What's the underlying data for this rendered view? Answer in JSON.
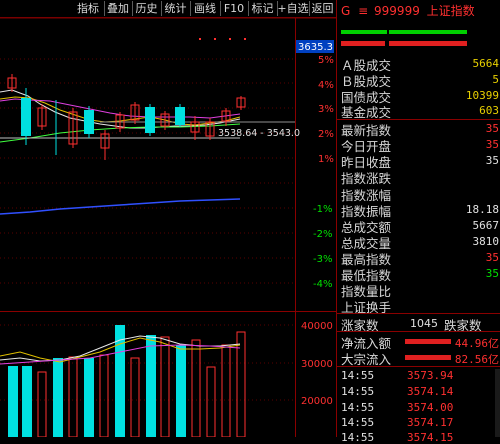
{
  "toolbar": {
    "items": [
      "指标",
      "叠加",
      "历史",
      "统计",
      "画线",
      "F10",
      "标记",
      "+自选",
      "返回"
    ]
  },
  "chart": {
    "price_marker": "3635.3",
    "range_label": "3538.64 - 3543.0",
    "pct_ticks": [
      "5%",
      "4%",
      "3%",
      "2%",
      "1%",
      "-1%",
      "-2%",
      "-3%",
      "-4%"
    ],
    "vol_ticks": [
      "40000",
      "30000",
      "20000"
    ]
  },
  "panel": {
    "badge": "G",
    "menu_glyph": "≡",
    "code": "999999",
    "name": "上证指数",
    "rows": [
      {
        "label": "Ａ股成交",
        "value": "5664"
      },
      {
        "label": "Ｂ股成交",
        "value": "5"
      },
      {
        "label": "国债成交",
        "value": "10399"
      },
      {
        "label": "基金成交",
        "value": "603"
      },
      {
        "label": "最新指数",
        "value": "35"
      },
      {
        "label": "今日开盘",
        "value": "35"
      },
      {
        "label": "昨日收盘",
        "value": "35"
      },
      {
        "label": "指数涨跌",
        "value": ""
      },
      {
        "label": "指数涨幅",
        "value": ""
      },
      {
        "label": "指数振幅",
        "value": "18.18"
      },
      {
        "label": "总成交额",
        "value": "5667"
      },
      {
        "label": "总成交量",
        "value": "3810"
      },
      {
        "label": "最高指数",
        "value": "35"
      },
      {
        "label": "最低指数",
        "value": "35"
      },
      {
        "label": "指数量比",
        "value": ""
      },
      {
        "label": "上证换手",
        "value": ""
      }
    ],
    "breadth": {
      "up_label": "涨家数",
      "up_value": "1045",
      "down_label": "跌家数"
    },
    "flows": [
      {
        "label": "净流入额",
        "value": "44.96亿"
      },
      {
        "label": "大宗流入",
        "value": "82.56亿"
      }
    ],
    "ticks": [
      {
        "time": "14:55",
        "price": "3573.94"
      },
      {
        "time": "14:55",
        "price": "3574.14"
      },
      {
        "time": "14:55",
        "price": "3574.00"
      },
      {
        "time": "14:55",
        "price": "3574.17"
      },
      {
        "time": "14:55",
        "price": "3574.15"
      }
    ],
    "colors": {
      "up": "#ff3030",
      "down": "#00e0e0",
      "accent": "#ff0000"
    }
  }
}
